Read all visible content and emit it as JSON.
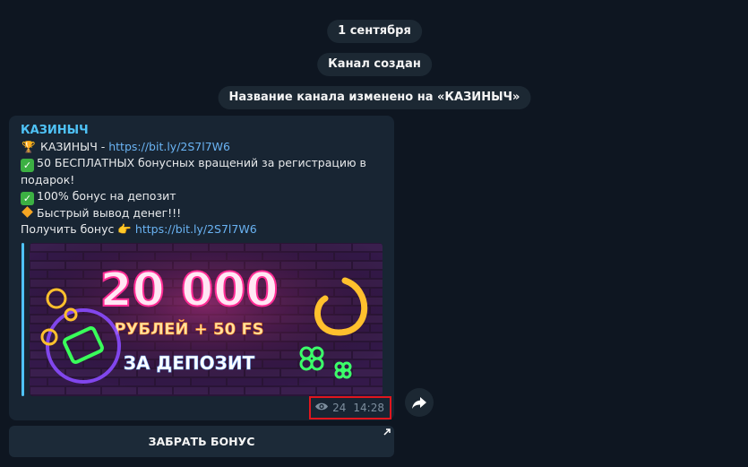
{
  "service_messages": {
    "date": "1 сентября",
    "created": "Канал создан",
    "renamed": "Название канала изменено на «КАЗИНЫЧ»"
  },
  "message": {
    "channel_name": "КАЗИНЫЧ",
    "line1_text": "КАЗИНЫЧ - ",
    "line1_link": "https://bit.ly/2S7l7W6",
    "line2_text": "50 БЕСПЛАТНЫХ бонусных вращений за регистрацию в подарок!",
    "line3_text": "100% бонус на депозит",
    "line4_text": "Быстрый вывод денег!!!",
    "line5_text": "Получить бонус ",
    "line5_link": "https://bit.ly/2S7l7W6",
    "views": "24",
    "time": "14:28",
    "banner": {
      "headline": "20 000",
      "subline": "РУБЛЕЙ + 50 FS",
      "tagline": "ЗА ДЕПОЗИТ"
    }
  },
  "buttons": {
    "bonus_label": "ЗАБРАТЬ БОНУС"
  },
  "icons": {
    "trophy": "trophy-icon",
    "check": "check-mark-icon",
    "diamond": "orange-diamond-icon",
    "pointing_hand": "pointing-hand-icon",
    "eye": "eye-icon",
    "share": "share-arrow-icon",
    "external": "external-link-icon"
  },
  "colors": {
    "background": "#0e1621",
    "bubble": "#182533",
    "channel_name": "#4fc3f7",
    "link": "#6ab3f3",
    "highlight_border": "#e0161e"
  }
}
